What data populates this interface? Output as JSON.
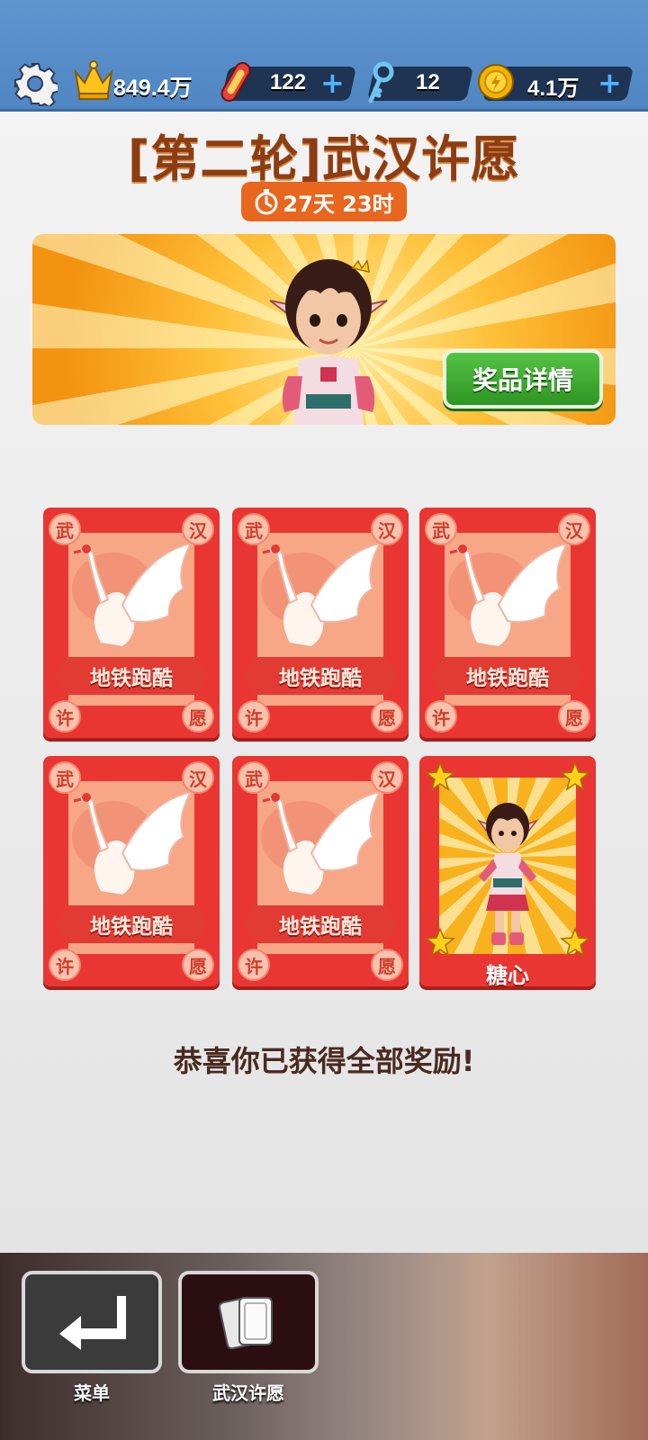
{
  "topbar": {
    "settings_icon": "gear-icon",
    "score": {
      "icon": "crown-icon",
      "value": "849.4万"
    },
    "boards": {
      "icon": "hoverboard-icon",
      "value": "122",
      "plus": "+"
    },
    "keys": {
      "icon": "key-icon",
      "value": "12"
    },
    "coins": {
      "icon": "coin-icon",
      "value": "4.1万",
      "plus": "+"
    }
  },
  "event": {
    "title": "[第二轮]武汉许愿",
    "timer": "27天 23时",
    "prize_button": "奖品详情"
  },
  "cards": [
    {
      "tl": "武",
      "tr": "汉",
      "bl": "许",
      "br": "愿",
      "label": "地铁跑酷"
    },
    {
      "tl": "武",
      "tr": "汉",
      "bl": "许",
      "br": "愿",
      "label": "地铁跑酷"
    },
    {
      "tl": "武",
      "tr": "汉",
      "bl": "许",
      "br": "愿",
      "label": "地铁跑酷"
    },
    {
      "tl": "武",
      "tr": "汉",
      "bl": "许",
      "br": "愿",
      "label": "地铁跑酷"
    },
    {
      "tl": "武",
      "tr": "汉",
      "bl": "许",
      "br": "愿",
      "label": "地铁跑酷"
    }
  ],
  "character_card": {
    "name": "糖心"
  },
  "message": "恭喜你已获得全部奖励!",
  "bottom_nav": {
    "menu_label": "菜单",
    "event_label": "武汉许愿"
  },
  "colors": {
    "topbar": "#5f95cf",
    "card_red": "#e93632",
    "title_brown": "#8d3d12",
    "timer_orange": "#e8661e",
    "button_green": "#3fae32"
  }
}
